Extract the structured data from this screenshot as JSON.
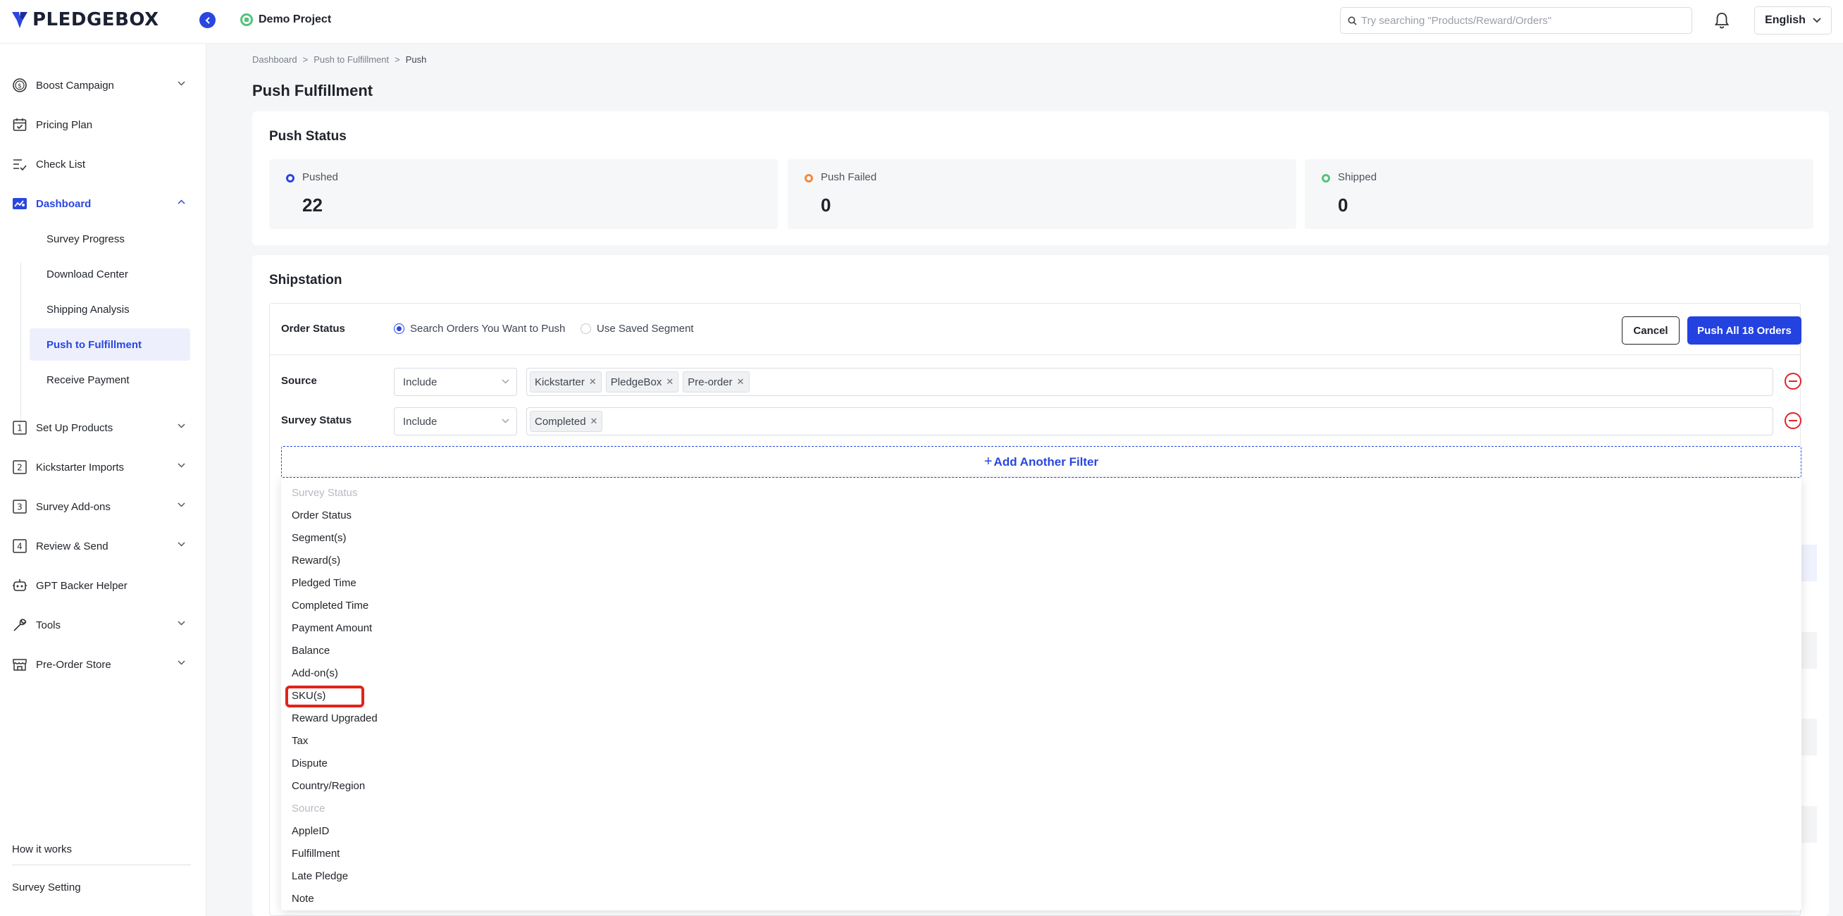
{
  "app": {
    "brand": "PLEDGEBOX",
    "project_name": "Demo Project",
    "search_placeholder": "Try searching \"Products/Reward/Orders\"",
    "language": "English"
  },
  "sidebar": {
    "items": [
      {
        "label": "Boost Campaign",
        "icon": "dollar-circle-icon",
        "expandable": true
      },
      {
        "label": "Pricing Plan",
        "icon": "calendar-check-icon",
        "expandable": false
      },
      {
        "label": "Check List",
        "icon": "checklist-icon",
        "expandable": false
      },
      {
        "label": "Dashboard",
        "icon": "dashboard-icon",
        "expandable": true,
        "expanded": true
      },
      {
        "label": "Set Up Products",
        "icon": "step-1-icon",
        "expandable": true
      },
      {
        "label": "Kickstarter Imports",
        "icon": "step-2-icon",
        "expandable": true
      },
      {
        "label": "Survey Add-ons",
        "icon": "step-3-icon",
        "expandable": true
      },
      {
        "label": "Review & Send",
        "icon": "step-4-icon",
        "expandable": true
      },
      {
        "label": "GPT Backer Helper",
        "icon": "robot-icon",
        "expandable": false
      },
      {
        "label": "Tools",
        "icon": "wrench-icon",
        "expandable": true
      },
      {
        "label": "Pre-Order Store",
        "icon": "store-icon",
        "expandable": true
      }
    ],
    "dashboard_children": [
      "Survey Progress",
      "Download Center",
      "Shipping Analysis",
      "Push to Fulfillment",
      "Receive Payment"
    ],
    "active_child": "Push to Fulfillment",
    "footer": [
      "How it works",
      "Survey Setting"
    ]
  },
  "breadcrumb": [
    "Dashboard",
    ">",
    "Push to Fulfillment",
    ">",
    "Push"
  ],
  "page_title": "Push Fulfillment",
  "push_status": {
    "title": "Push Status",
    "stats": [
      {
        "label": "Pushed",
        "value": "22",
        "color": "#2a46e0"
      },
      {
        "label": "Push Failed",
        "value": "0",
        "color": "#f08a3c"
      },
      {
        "label": "Shipped",
        "value": "0",
        "color": "#52c47a"
      }
    ]
  },
  "shipstation": {
    "title": "Shipstation",
    "order_status_label": "Order Status",
    "radio_options": [
      "Search Orders You Want to Push",
      "Use Saved Segment"
    ],
    "radio_selected": "Search Orders You Want to Push",
    "cancel_label": "Cancel",
    "push_label": "Push All 18 Orders",
    "filters": [
      {
        "label": "Source",
        "operator": "Include",
        "tags": [
          "Kickstarter",
          "PledgeBox",
          "Pre-order"
        ]
      },
      {
        "label": "Survey Status",
        "operator": "Include",
        "tags": [
          "Completed"
        ]
      }
    ],
    "add_filter_label": "Add Another Filter"
  },
  "dropdown": {
    "items": [
      {
        "label": "Survey Status",
        "disabled": true
      },
      {
        "label": "Order Status",
        "disabled": false
      },
      {
        "label": "Segment(s)",
        "disabled": false
      },
      {
        "label": "Reward(s)",
        "disabled": false
      },
      {
        "label": "Pledged Time",
        "disabled": false
      },
      {
        "label": "Completed Time",
        "disabled": false
      },
      {
        "label": "Payment Amount",
        "disabled": false
      },
      {
        "label": "Balance",
        "disabled": false
      },
      {
        "label": "Add-on(s)",
        "disabled": false
      },
      {
        "label": "SKU(s)",
        "disabled": false,
        "highlighted": true
      },
      {
        "label": "Reward Upgraded",
        "disabled": false
      },
      {
        "label": "Tax",
        "disabled": false
      },
      {
        "label": "Dispute",
        "disabled": false
      },
      {
        "label": "Country/Region",
        "disabled": false
      },
      {
        "label": "Source",
        "disabled": true
      },
      {
        "label": "AppleID",
        "disabled": false
      },
      {
        "label": "Fulfillment",
        "disabled": false
      },
      {
        "label": "Late Pledge",
        "disabled": false
      },
      {
        "label": "Note",
        "disabled": false
      }
    ]
  },
  "colors": {
    "accent": "#2a46e0",
    "danger": "#e0242a",
    "highlight_box": "#e2231a"
  }
}
